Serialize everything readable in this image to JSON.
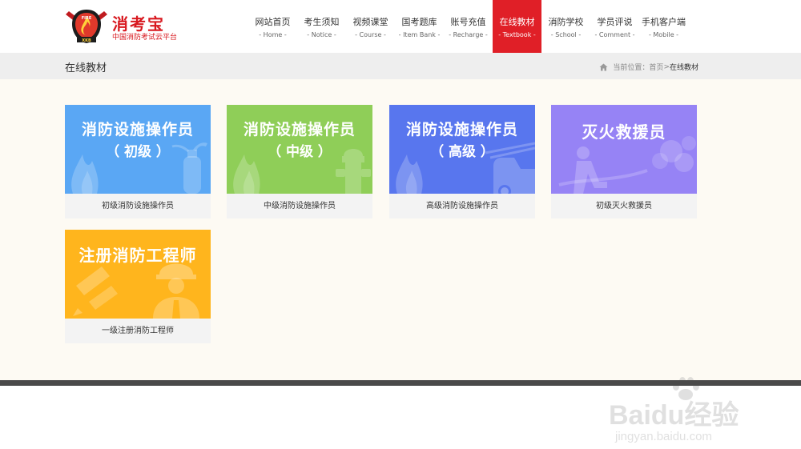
{
  "brand": {
    "name": "消考宝",
    "subtitle": "中国消防考试云平台",
    "logo_text_top": "FIRE",
    "logo_text_bottom": "XKB"
  },
  "nav": [
    {
      "label": "网站首页",
      "sub": "- Home -"
    },
    {
      "label": "考生须知",
      "sub": "- Notice -"
    },
    {
      "label": "视频课堂",
      "sub": "- Course -"
    },
    {
      "label": "国考题库",
      "sub": "- Item Bank -"
    },
    {
      "label": "账号充值",
      "sub": "- Recharge -"
    },
    {
      "label": "在线教材",
      "sub": "- Textbook -",
      "active": true
    },
    {
      "label": "消防学校",
      "sub": "- School -"
    },
    {
      "label": "学员评说",
      "sub": "- Comment -"
    },
    {
      "label": "手机客户端",
      "sub": "- Mobile -"
    }
  ],
  "page": {
    "title": "在线教材"
  },
  "breadcrumb": {
    "prefix": "当前位置：",
    "home": "首页",
    "sep": " > ",
    "current": "在线教材"
  },
  "cards": [
    {
      "line1": "消防设施操作员",
      "line2": "（ 初级 ）",
      "caption": "初级消防设施操作员",
      "color": "#5aa7f4"
    },
    {
      "line1": "消防设施操作员",
      "line2": "（ 中级 ）",
      "caption": "中级消防设施操作员",
      "color": "#8fce58"
    },
    {
      "line1": "消防设施操作员",
      "line2": "（ 高级 ）",
      "caption": "高级消防设施操作员",
      "color": "#5876ee"
    },
    {
      "line1": "灭火救援员",
      "line2": "",
      "caption": "初级灭火救援员",
      "color": "#9683f5"
    },
    {
      "line1": "注册消防工程师",
      "line2": "",
      "caption": "一级注册消防工程师",
      "color": "#ffb51d"
    }
  ],
  "watermark": {
    "brand": "Baidu经验",
    "url": "jingyan.baidu.com"
  },
  "colors": {
    "accent": "#e01f27",
    "titlebar": "#eeeeee",
    "content_bg": "#fdfaf3"
  }
}
